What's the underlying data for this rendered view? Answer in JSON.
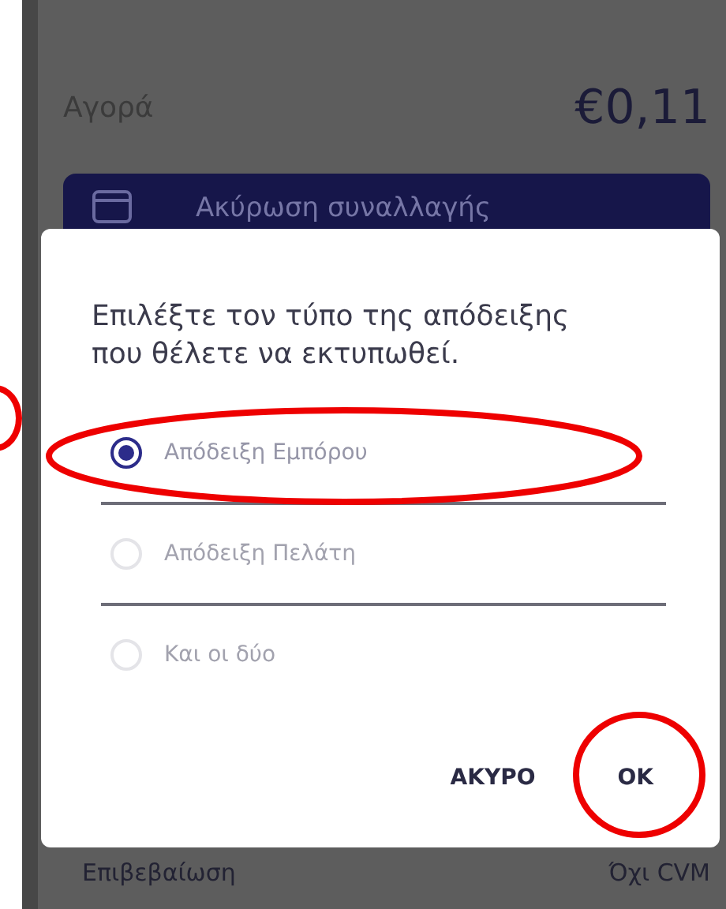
{
  "background": {
    "label": "Αγορά",
    "amount": "€0,11",
    "action_button": "Ακύρωση συναλλαγής",
    "footer_label": "Επιβεβαίωση",
    "footer_value": "Όχι CVM"
  },
  "dialog": {
    "message": "Επιλέξτε τον τύπο της απόδειξης που θέλετε να εκτυπωθεί.",
    "options": [
      {
        "label": "Απόδειξη Εμπόρου",
        "selected": true,
        "circled": true
      },
      {
        "label": "Απόδειξη Πελάτη",
        "selected": false,
        "circled": false
      },
      {
        "label": "Και οι δύο",
        "selected": false,
        "circled": false
      }
    ],
    "buttons": [
      {
        "label": "ΑΚΥΡΟ",
        "circled": false
      },
      {
        "label": "OK",
        "circled": true
      }
    ]
  },
  "edge_circle": true
}
